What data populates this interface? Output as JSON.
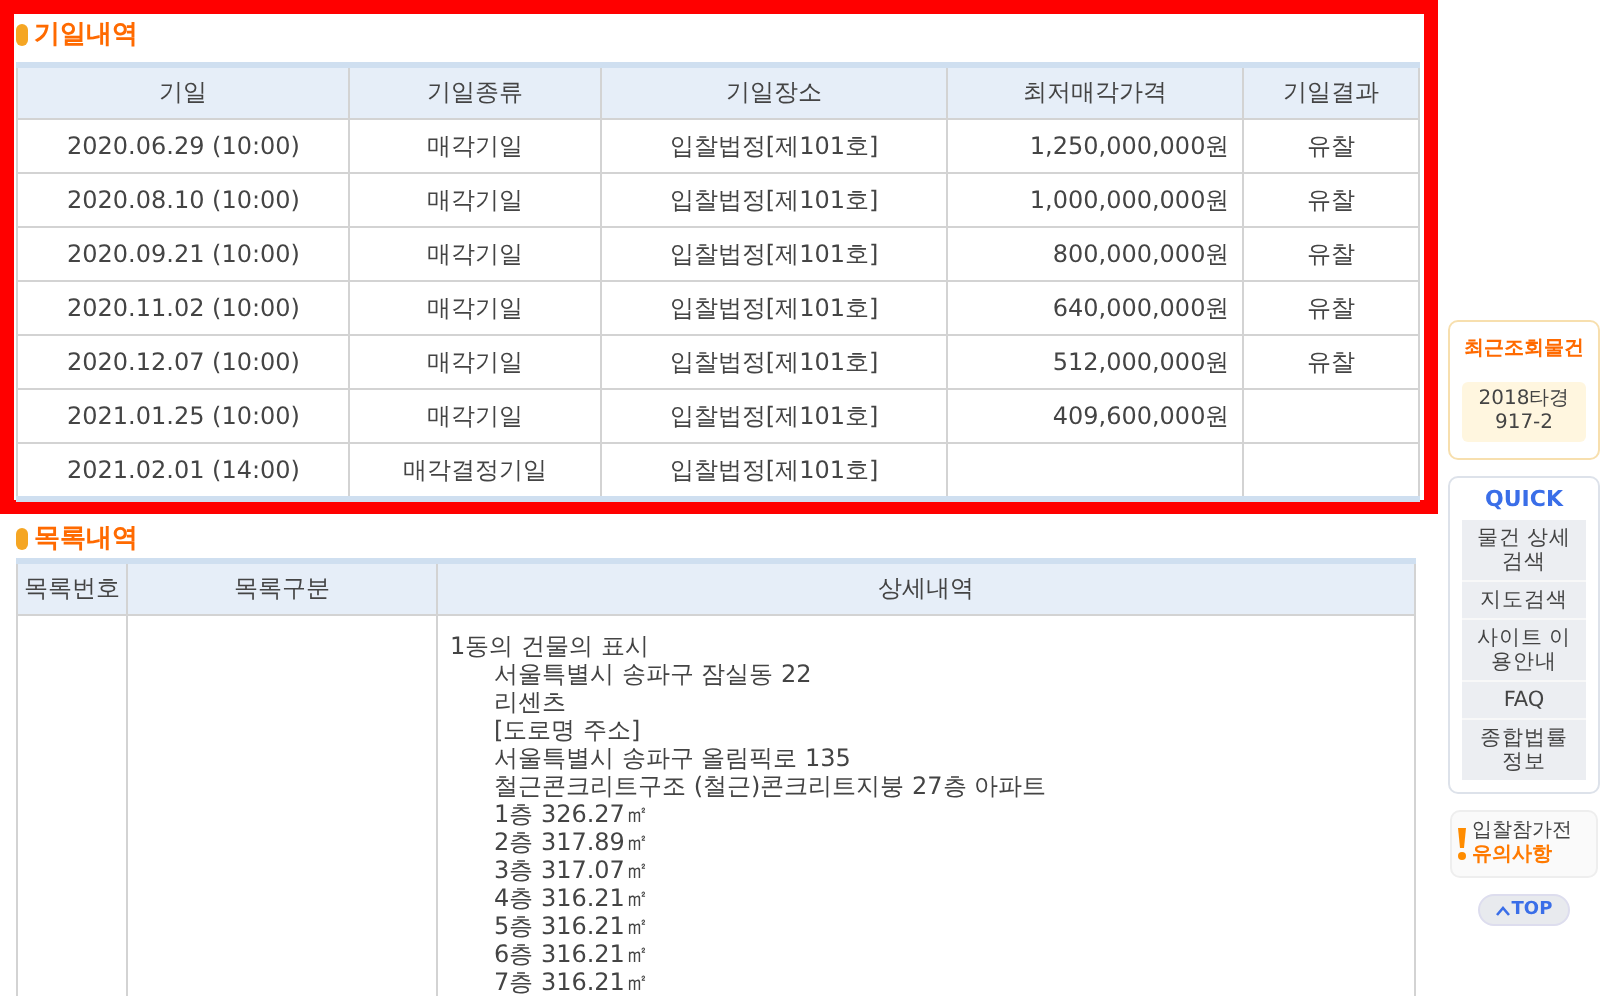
{
  "auction_dates": {
    "title": "기일내역",
    "columns": [
      "기일",
      "기일종류",
      "기일장소",
      "최저매각가격",
      "기일결과"
    ],
    "rows": [
      {
        "date": "2020.06.29 (10:00)",
        "type": "매각기일",
        "place": "입찰법정[제101호]",
        "min_price": "1,250,000,000원",
        "result": "유찰"
      },
      {
        "date": "2020.08.10 (10:00)",
        "type": "매각기일",
        "place": "입찰법정[제101호]",
        "min_price": "1,000,000,000원",
        "result": "유찰"
      },
      {
        "date": "2020.09.21 (10:00)",
        "type": "매각기일",
        "place": "입찰법정[제101호]",
        "min_price": "800,000,000원",
        "result": "유찰"
      },
      {
        "date": "2020.11.02 (10:00)",
        "type": "매각기일",
        "place": "입찰법정[제101호]",
        "min_price": "640,000,000원",
        "result": "유찰"
      },
      {
        "date": "2020.12.07 (10:00)",
        "type": "매각기일",
        "place": "입찰법정[제101호]",
        "min_price": "512,000,000원",
        "result": "유찰"
      },
      {
        "date": "2021.01.25 (10:00)",
        "type": "매각기일",
        "place": "입찰법정[제101호]",
        "min_price": "409,600,000원"
      },
      {
        "date": "2021.02.01 (14:00)",
        "type": "매각결정기일",
        "place": "입찰법정[제101호]"
      }
    ]
  },
  "listing": {
    "title": "목록내역",
    "columns": [
      "목록번호",
      "목록구분",
      "상세내역"
    ],
    "rows": [
      {
        "details": {
          "text": "1동의 건물의 표시",
          "children": [
            {
              "text": "서울특별시 송파구 잠실동 22"
            },
            {
              "text": "리센츠"
            },
            {
              "text": "[도로명 주소]"
            },
            {
              "text": "서울특별시 송파구 올림픽로 135"
            },
            {
              "text": "철근콘크리트구조 (철근)콘크리트지붕 27층 아파트"
            },
            {
              "text": "1층 326.27㎡"
            },
            {
              "text": "2층 317.89㎡"
            },
            {
              "text": "3층 317.07㎡"
            },
            {
              "text": "4층 316.21㎡"
            },
            {
              "text": "5층 316.21㎡"
            },
            {
              "text": "6층 316.21㎡"
            },
            {
              "text": "7층 316.21㎡"
            }
          ]
        }
      }
    ]
  },
  "sidebar": {
    "recent": {
      "title": "최근조회물건",
      "items": [
        "2018타경 917-2"
      ]
    },
    "quick": {
      "title": "QUICK",
      "items": [
        "물건 상세검색",
        "지도검색",
        "사이트 이용안내",
        "FAQ",
        "종합법률 정보"
      ]
    },
    "notice": {
      "line1": "입찰참가전",
      "line2": "유의사항"
    },
    "top_button": "TOP"
  }
}
